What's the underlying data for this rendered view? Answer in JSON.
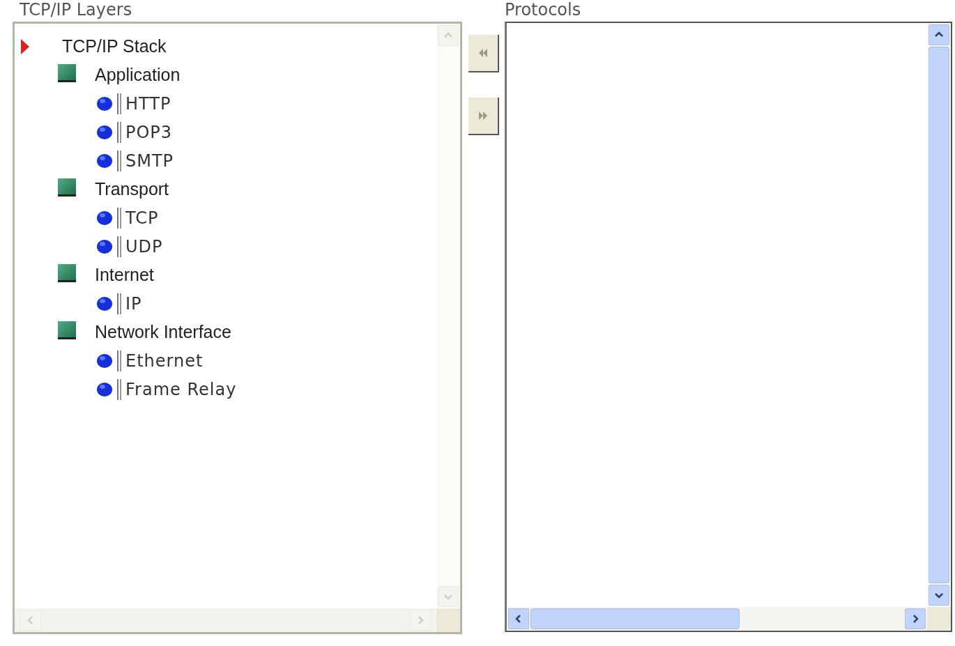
{
  "left_panel": {
    "title": "TCP/IP Layers",
    "tree": [
      {
        "label": "TCP/IP Stack",
        "kind": "root",
        "children": [
          {
            "label": "Application",
            "kind": "layer",
            "children": [
              {
                "label": "HTTP",
                "kind": "protocol"
              },
              {
                "label": "POP3",
                "kind": "protocol"
              },
              {
                "label": "SMTP",
                "kind": "protocol"
              }
            ]
          },
          {
            "label": "Transport",
            "kind": "layer",
            "children": [
              {
                "label": "TCP",
                "kind": "protocol"
              },
              {
                "label": "UDP",
                "kind": "protocol"
              }
            ]
          },
          {
            "label": "Internet",
            "kind": "layer",
            "children": [
              {
                "label": "IP",
                "kind": "protocol"
              }
            ]
          },
          {
            "label": "Network Interface",
            "kind": "layer",
            "children": [
              {
                "label": "Ethernet",
                "kind": "protocol"
              },
              {
                "label": "Frame Relay",
                "kind": "protocol"
              }
            ]
          }
        ]
      }
    ]
  },
  "move_buttons": [
    {
      "kind": "left"
    },
    {
      "kind": "right"
    }
  ],
  "right_panel": {
    "title": "Protocols"
  }
}
